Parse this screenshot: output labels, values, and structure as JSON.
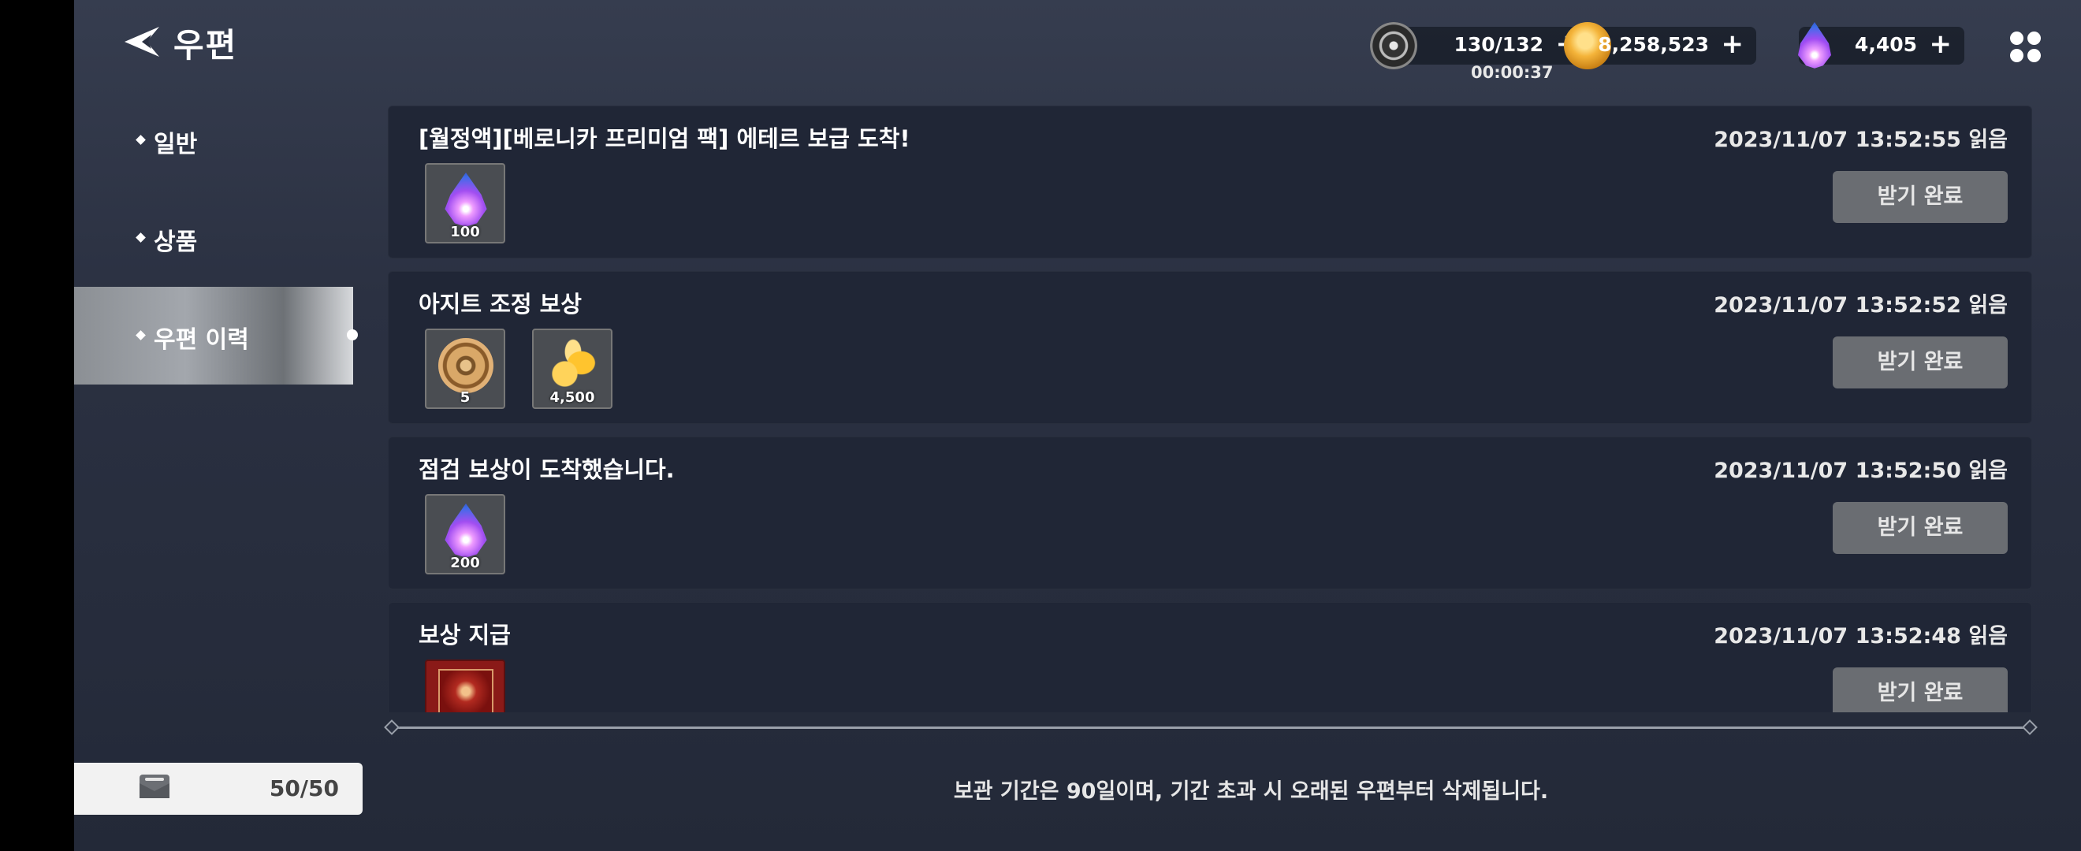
{
  "header": {
    "title": "우편",
    "back_icon": "back-arrow-icon",
    "resources": {
      "stamina": {
        "value": "130/132",
        "timer": "00:00:37",
        "plus": "+"
      },
      "gold": {
        "value": "8,258,523",
        "plus": "+"
      },
      "gem": {
        "value": "4,405",
        "plus": "+"
      }
    },
    "menu_icon": "grid-menu-icon"
  },
  "sidebar": {
    "items": [
      {
        "label": "일반"
      },
      {
        "label": "상품"
      },
      {
        "label": "우편 이력",
        "active": true
      }
    ],
    "capacity": "50/50"
  },
  "mails": [
    {
      "title": "[월정액][베로니카 프리미엄 팩] 에테르 보급 도착!",
      "time": "2023/11/07 13:52:55 읽음",
      "button": "받기 완료",
      "items": [
        {
          "icon": "ether-gem-icon",
          "qty": "100"
        }
      ]
    },
    {
      "title": "아지트 조정 보상",
      "time": "2023/11/07 13:52:52 읽음",
      "button": "받기 완료",
      "items": [
        {
          "icon": "gear-medal-icon",
          "qty": "5"
        },
        {
          "icon": "gold-coins-icon",
          "qty": "4,500"
        }
      ]
    },
    {
      "title": "점검 보상이 도착했습니다.",
      "time": "2023/11/07 13:52:50 읽음",
      "button": "받기 완료",
      "items": [
        {
          "icon": "ether-gem-icon",
          "qty": "200"
        }
      ]
    },
    {
      "title": "보상 지급",
      "time": "2023/11/07 13:52:48 읽음",
      "button": "받기 완료",
      "items": [
        {
          "icon": "red-card-icon",
          "qty": ""
        }
      ]
    }
  ],
  "footer_note": "보관 기간은 90일이며, 기간 초과 시 오래된 우편부터 삭제됩니다."
}
